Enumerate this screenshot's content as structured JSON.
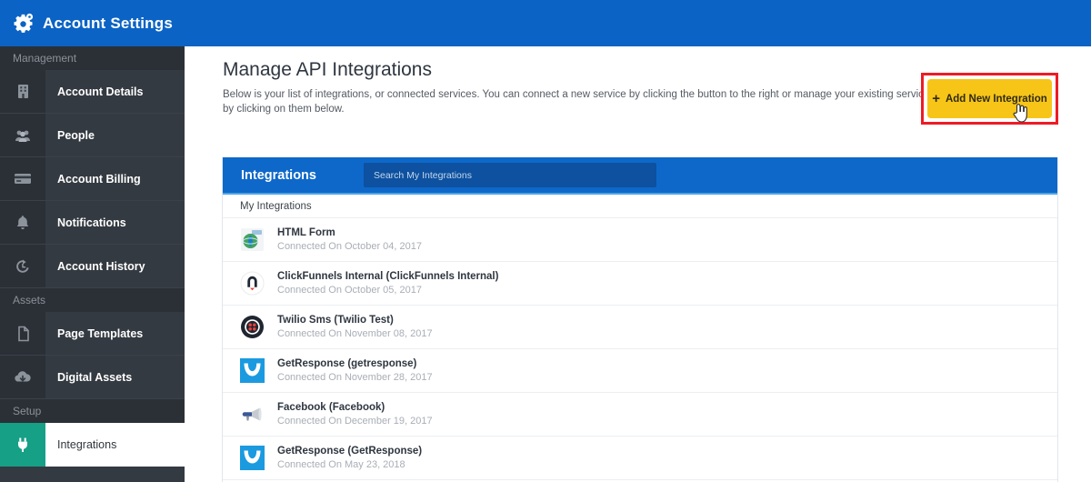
{
  "header": {
    "title": "Account Settings",
    "icon": "gears-icon",
    "bg_color": "#0b63c5"
  },
  "sidebar": {
    "sections": [
      {
        "label": "Management",
        "items": [
          {
            "label": "Account Details",
            "icon": "building-icon",
            "active": false
          },
          {
            "label": "People",
            "icon": "people-icon",
            "active": false
          },
          {
            "label": "Account Billing",
            "icon": "credit-card-icon",
            "active": false
          },
          {
            "label": "Notifications",
            "icon": "bell-icon",
            "active": false
          },
          {
            "label": "Account History",
            "icon": "history-clock-icon",
            "active": false
          }
        ]
      },
      {
        "label": "Assets",
        "items": [
          {
            "label": "Page Templates",
            "icon": "page-document-icon",
            "active": false
          },
          {
            "label": "Digital Assets",
            "icon": "cloud-download-icon",
            "active": false
          }
        ]
      },
      {
        "label": "Setup",
        "items": [
          {
            "label": "Integrations",
            "icon": "plug-icon",
            "active": true
          }
        ]
      }
    ],
    "active_accent_color": "#16a086"
  },
  "main": {
    "page_title": "Manage API Integrations",
    "page_description": "Below is your list of integrations, or connected services. You can connect a new service by clicking the button to the right or manage your existing services by clicking on them below.",
    "add_button": {
      "label": "Add New Integration",
      "plus": "+",
      "bg_color": "#f7c518",
      "highlight_color": "#ee1b24",
      "cursor": "hand-pointer-cursor"
    },
    "panel": {
      "title": "Integrations",
      "search_placeholder": "Search My Integrations",
      "search_value": "",
      "subheader": "My Integrations",
      "header_bg_color": "#0d68c9",
      "rows": [
        {
          "name": "HTML Form",
          "connected": "Connected On October 04, 2017",
          "icon": "html-form-globe-icon"
        },
        {
          "name": "ClickFunnels Internal (ClickFunnels Internal)",
          "connected": "Connected On October 05, 2017",
          "icon": "clickfunnels-logo-icon"
        },
        {
          "name": "Twilio Sms (Twilio Test)",
          "connected": "Connected On November 08, 2017",
          "icon": "twilio-logo-icon"
        },
        {
          "name": "GetResponse (getresponse)",
          "connected": "Connected On November 28, 2017",
          "icon": "getresponse-logo-icon"
        },
        {
          "name": "Facebook (Facebook)",
          "connected": "Connected On December 19, 2017",
          "icon": "megaphone-icon"
        },
        {
          "name": "GetResponse (GetResponse)",
          "connected": "Connected On May 23, 2018",
          "icon": "getresponse-logo-icon"
        }
      ]
    }
  }
}
